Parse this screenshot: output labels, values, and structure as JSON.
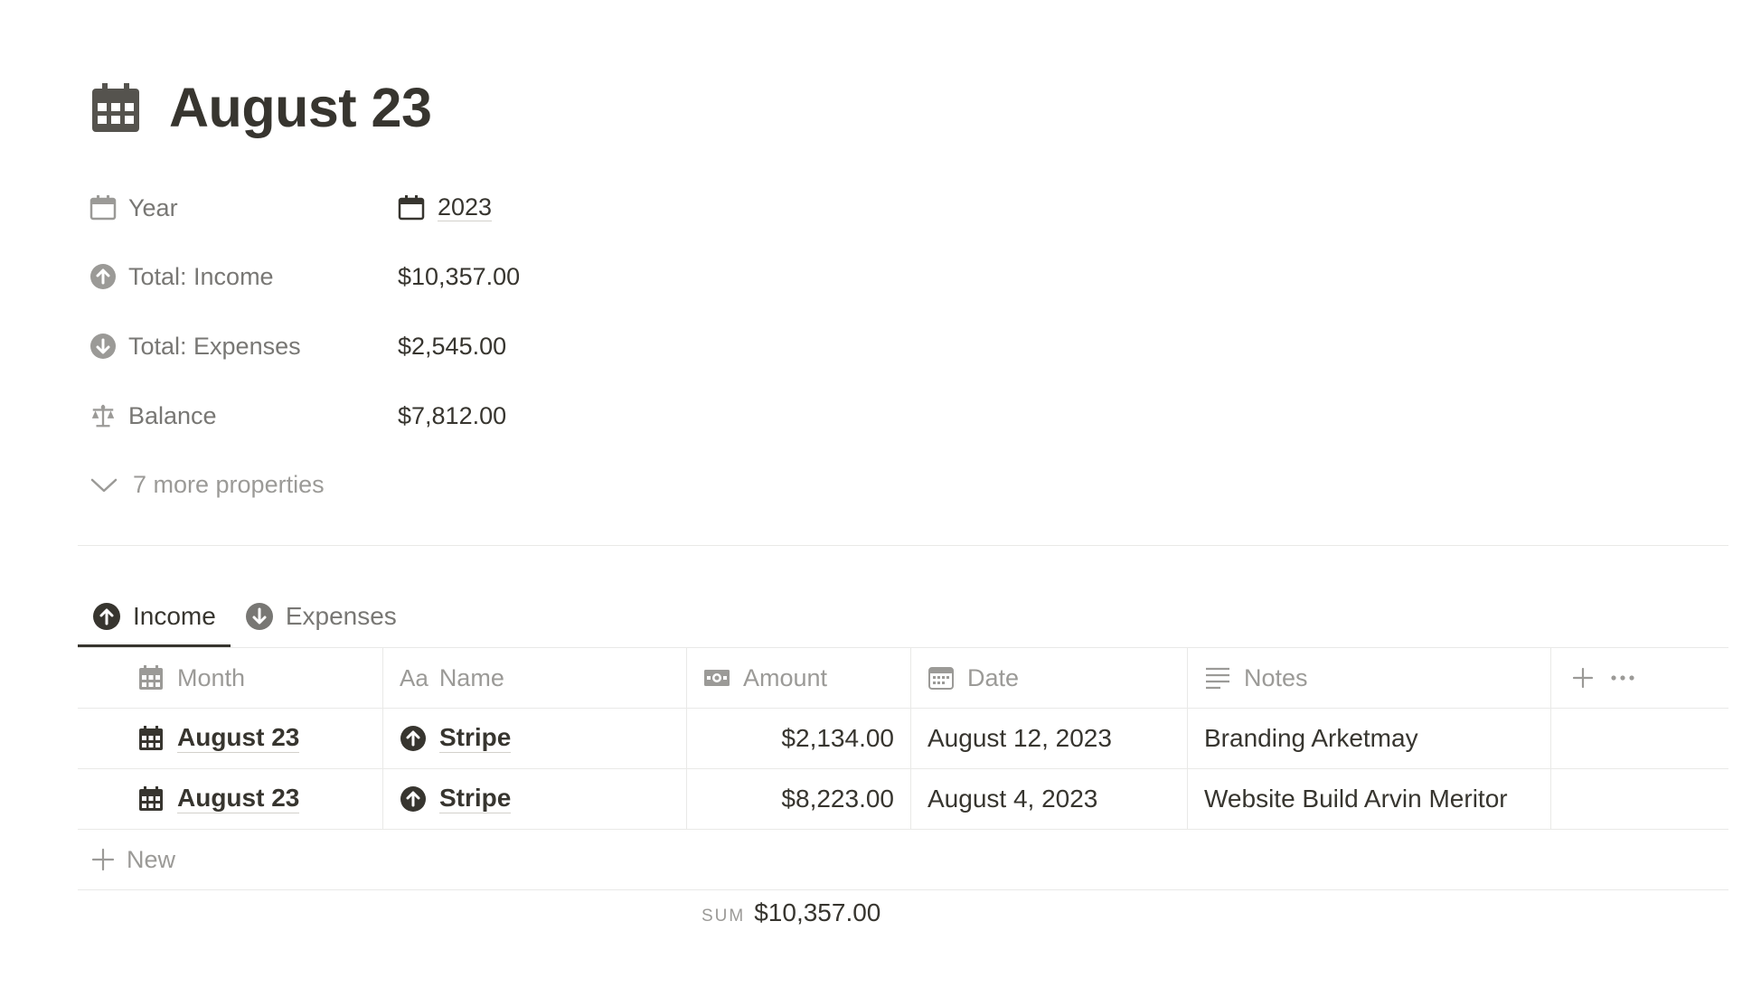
{
  "page": {
    "title": "August 23",
    "icon": "calendar-grid-icon"
  },
  "properties": [
    {
      "label": "Year",
      "icon": "calendar-icon",
      "value": "2023",
      "value_icon": "calendar-icon"
    },
    {
      "label": "Total: Income",
      "icon": "arrow-up-circle-icon",
      "value": "$10,357.00"
    },
    {
      "label": "Total: Expenses",
      "icon": "arrow-down-circle-icon",
      "value": "$2,545.00"
    },
    {
      "label": "Balance",
      "icon": "scale-icon",
      "value": "$7,812.00"
    }
  ],
  "more_properties": "7 more properties",
  "tabs": [
    {
      "label": "Income",
      "icon": "arrow-up-circle-icon",
      "active": true
    },
    {
      "label": "Expenses",
      "icon": "arrow-down-circle-icon",
      "active": false
    }
  ],
  "table": {
    "columns": [
      {
        "label": "Month",
        "icon": "calendar-grid-icon"
      },
      {
        "label": "Name",
        "icon_text": "Aa"
      },
      {
        "label": "Amount",
        "icon": "banknote-icon"
      },
      {
        "label": "Date",
        "icon": "calendar-icon"
      },
      {
        "label": "Notes",
        "icon": "text-lines-icon"
      }
    ],
    "rows": [
      {
        "month": "August 23",
        "name": "Stripe",
        "amount": "$2,134.00",
        "date": "August 12, 2023",
        "notes": "Branding Arketmay"
      },
      {
        "month": "August 23",
        "name": "Stripe",
        "amount": "$8,223.00",
        "date": "August 4, 2023",
        "notes": "Website Build Arvin Meritor"
      }
    ],
    "new_label": "New",
    "sum_label": "SUM",
    "sum_value": "$10,357.00"
  },
  "colors": {
    "text": "#37352f",
    "muted": "#787774",
    "light": "#9b9a97",
    "border": "#e9e9e7"
  }
}
